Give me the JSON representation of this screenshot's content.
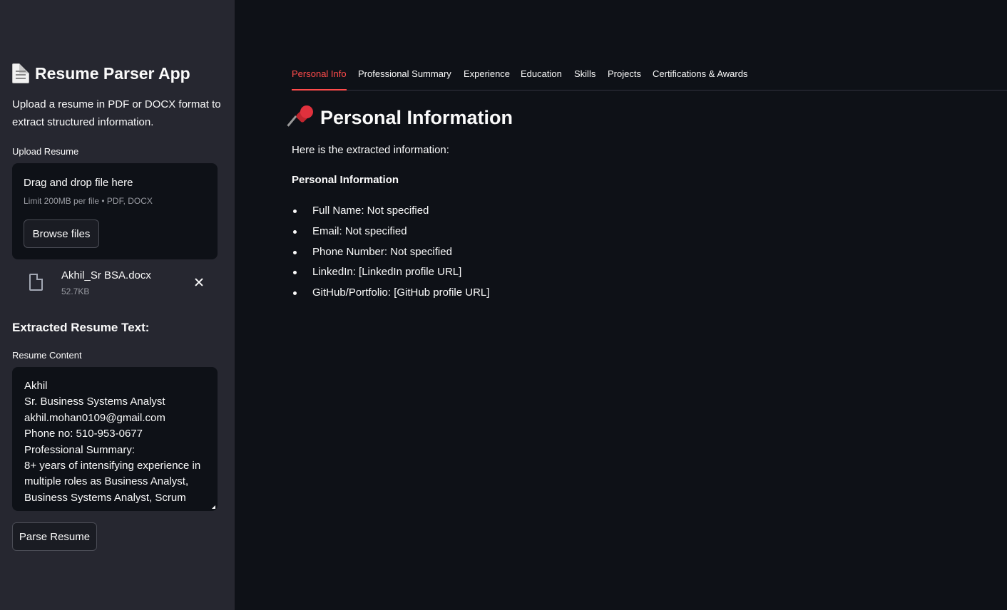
{
  "sidebar": {
    "title": "Resume Parser App",
    "intro": "Upload a resume in PDF or DOCX format to extract structured information.",
    "upload": {
      "label": "Upload Resume",
      "dropzone_title": "Drag and drop file here",
      "dropzone_limit": "Limit 200MB per file • PDF, DOCX",
      "browse_label": "Browse files"
    },
    "file": {
      "name": "Akhil_Sr BSA.docx",
      "size": "52.7KB"
    },
    "extracted_heading": "Extracted Resume Text:",
    "content_label": "Resume Content",
    "content_value": "Akhil\nSr. Business Systems Analyst\nakhil.mohan0109@gmail.com\nPhone no: 510-953-0677\nProfessional Summary:\n8+ years of intensifying experience in multiple roles as Business Analyst, Business Systems Analyst, Scrum",
    "parse_label": "Parse Resume"
  },
  "main": {
    "tabs": [
      {
        "label": "Personal Info",
        "active": true
      },
      {
        "label": "Professional Summary",
        "active": false
      },
      {
        "label": "Experience",
        "active": false
      },
      {
        "label": "Education",
        "active": false
      },
      {
        "label": "Skills",
        "active": false
      },
      {
        "label": "Projects",
        "active": false
      },
      {
        "label": "Certifications & Awards",
        "active": false
      }
    ],
    "section_title": "Personal Information",
    "intro": "Here is the extracted information:",
    "info_heading": "Personal Information",
    "items": [
      "Full Name: Not specified",
      "Email: Not specified",
      "Phone Number: Not specified",
      "LinkedIn: [LinkedIn profile URL]",
      "GitHub/Portfolio: [GitHub profile URL]"
    ]
  },
  "colors": {
    "sidebar_bg": "#262730",
    "main_bg": "#0e1117",
    "accent": "#ff4b4b",
    "text": "#fafafa"
  },
  "icons": {
    "title_icon": "document-icon",
    "section_icon": "pushpin-icon",
    "file_icon": "file-icon",
    "remove_icon": "close-icon"
  }
}
